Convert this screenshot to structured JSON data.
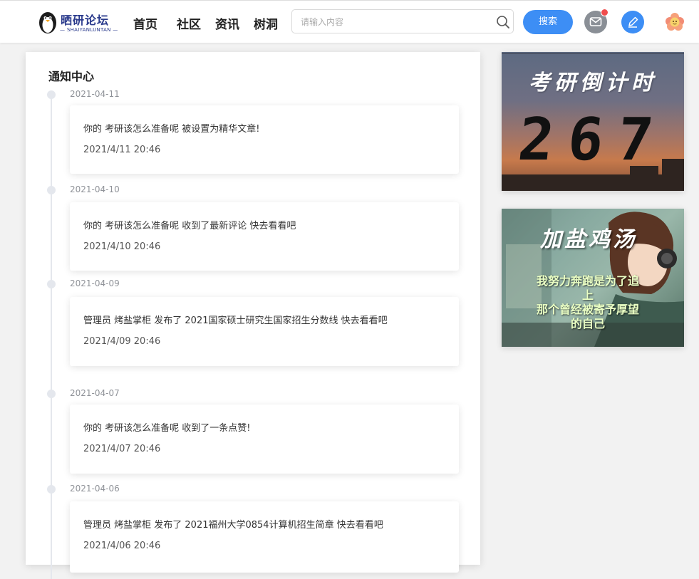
{
  "header": {
    "logo_title": "晒研论坛",
    "logo_sub": "— SHAIYANLUNTAN —",
    "nav": [
      "首页",
      "社区",
      "资讯",
      "树洞"
    ],
    "search_placeholder": "请输入内容",
    "search_button": "搜索"
  },
  "panel": {
    "title": "通知中心",
    "items": [
      {
        "date": "2021-04-11",
        "message": "你的 考研该怎么准备呢 被设置为精华文章!",
        "time": "2021/4/11 20:46"
      },
      {
        "date": "2021-04-10",
        "message": "你的 考研该怎么准备呢 收到了最新评论 快去看看吧",
        "time": "2021/4/10 20:46"
      },
      {
        "date": "2021-04-09",
        "message": "管理员 烤盐掌柜 发布了 2021国家硕士研究生国家招生分数线 快去看看吧",
        "time": "2021/4/09 20:46"
      },
      {
        "date": "2021-04-07",
        "message": "你的 考研该怎么准备呢 收到了一条点赞!",
        "time": "2021/4/07 20:46"
      },
      {
        "date": "2021-04-06",
        "message": "管理员 烤盐掌柜 发布了 2021福州大学0854计算机招生简章 快去看看吧",
        "time": "2021/4/06 20:46"
      }
    ]
  },
  "sidebar": {
    "countdown_title": "考研倒计时",
    "countdown_value": "267",
    "motto_title": "加盐鸡汤",
    "motto_lines": [
      "我努力奔跑是为了追",
      "上",
      "那个曾经被寄予厚望",
      "的自己"
    ]
  },
  "colors": {
    "accent": "#3d8ef5",
    "notify_dot": "#f04d4d",
    "timeline": "#e4e7ed"
  },
  "icons": {
    "logo": "penguin-logo-icon",
    "search": "search-icon",
    "mail": "mail-icon",
    "edit": "edit-icon",
    "avatar": "flower-avatar-icon"
  }
}
